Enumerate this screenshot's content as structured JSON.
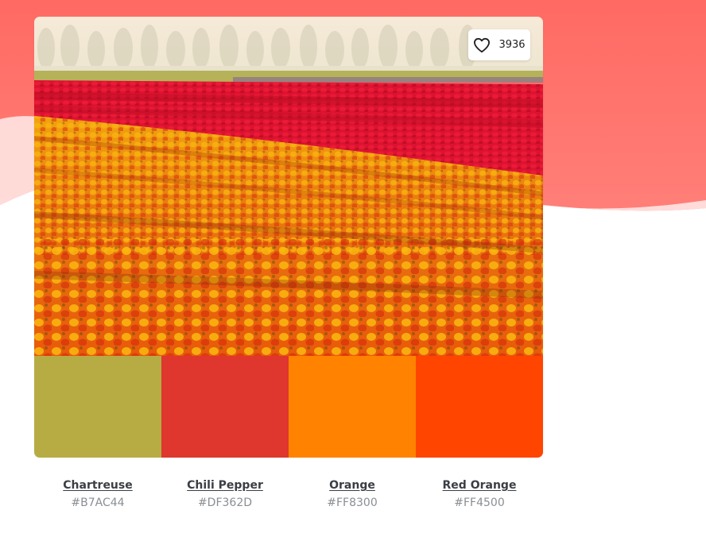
{
  "like": {
    "icon": "heart-icon",
    "count": "3936"
  },
  "colors": {
    "accent": "#ff6e66"
  },
  "palette": [
    {
      "name": "Chartreuse",
      "hex": "#B7AC44"
    },
    {
      "name": "Chili Pepper",
      "hex": "#DF362D"
    },
    {
      "name": "Orange",
      "hex": "#FF8300"
    },
    {
      "name": "Red Orange",
      "hex": "#FF4500"
    }
  ]
}
